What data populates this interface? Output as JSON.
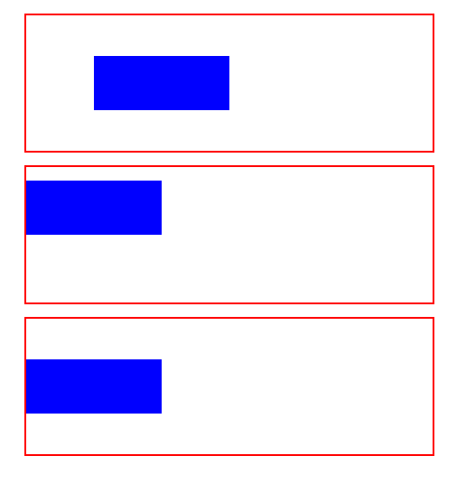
{
  "colors": {
    "frame_border": "#ff0000",
    "block_fill": "#0000ff",
    "background": "#ffffff"
  }
}
